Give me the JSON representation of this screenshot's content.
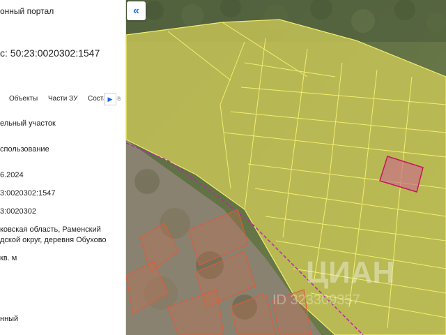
{
  "panel": {
    "portal_title": "онный портал",
    "cadastral_label": "с: 50:23:0020302:1547",
    "tabs": [
      "Объекты",
      "Части ЗУ",
      "Соста"
    ],
    "tab_more_icon": "chevron-right-icon",
    "tab_cut": "в",
    "fields": {
      "type": "ельный участок",
      "use": "спользование",
      "date": "6.2024",
      "number": "3:0020302:1547",
      "quarter": "3:0020302",
      "address_line1": "ковская область, Раменский",
      "address_line2": "дской округ, деревня Обухово",
      "area": "кв. м",
      "status": "нный"
    }
  },
  "map": {
    "collapse_icon": "double-chevron-left-icon",
    "collapse_label": "«",
    "watermark": "ЦИАН",
    "watermark_id": "ID 323309357",
    "colors": {
      "parcel_fill": "#d8d25a",
      "parcel_line": "#f2ee6c",
      "selected_fill": "#c86a8a",
      "selected_line": "#c2185b",
      "boundary": "#b0309a",
      "other_parcels": "#e05a3a"
    }
  }
}
